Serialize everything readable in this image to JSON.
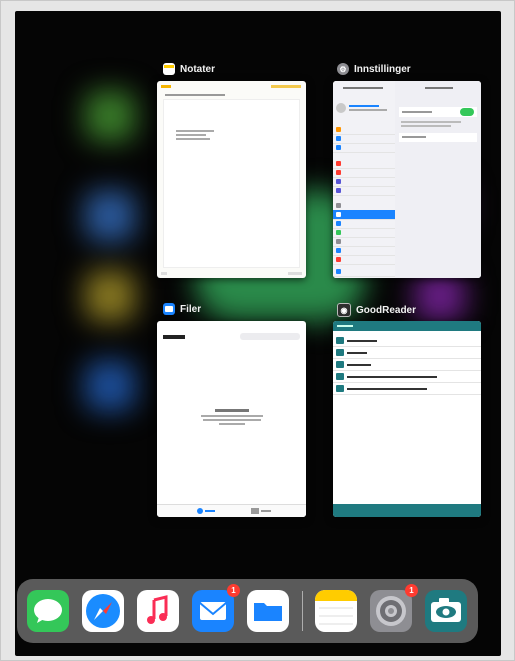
{
  "windows": [
    {
      "name": "Notater",
      "icon": "notes-icon"
    },
    {
      "name": "Innstillinger",
      "icon": "settings-gear-icon"
    },
    {
      "name": "Filer",
      "icon": "files-folder-icon"
    },
    {
      "name": "GoodReader",
      "icon": "goodreader-eye-icon"
    }
  ],
  "dock": {
    "apps": [
      "Messages",
      "Safari",
      "Music",
      "Mail",
      "Files",
      "Notes",
      "Settings",
      "GoodReader"
    ],
    "mail_badge": "1",
    "settings_badge": "1"
  },
  "colors": {
    "ios_blue": "#1a84ff",
    "badge_red": "#ff3b30",
    "goodreader_teal": "#1f7a80",
    "notes_yellow": "#ffcc00"
  }
}
